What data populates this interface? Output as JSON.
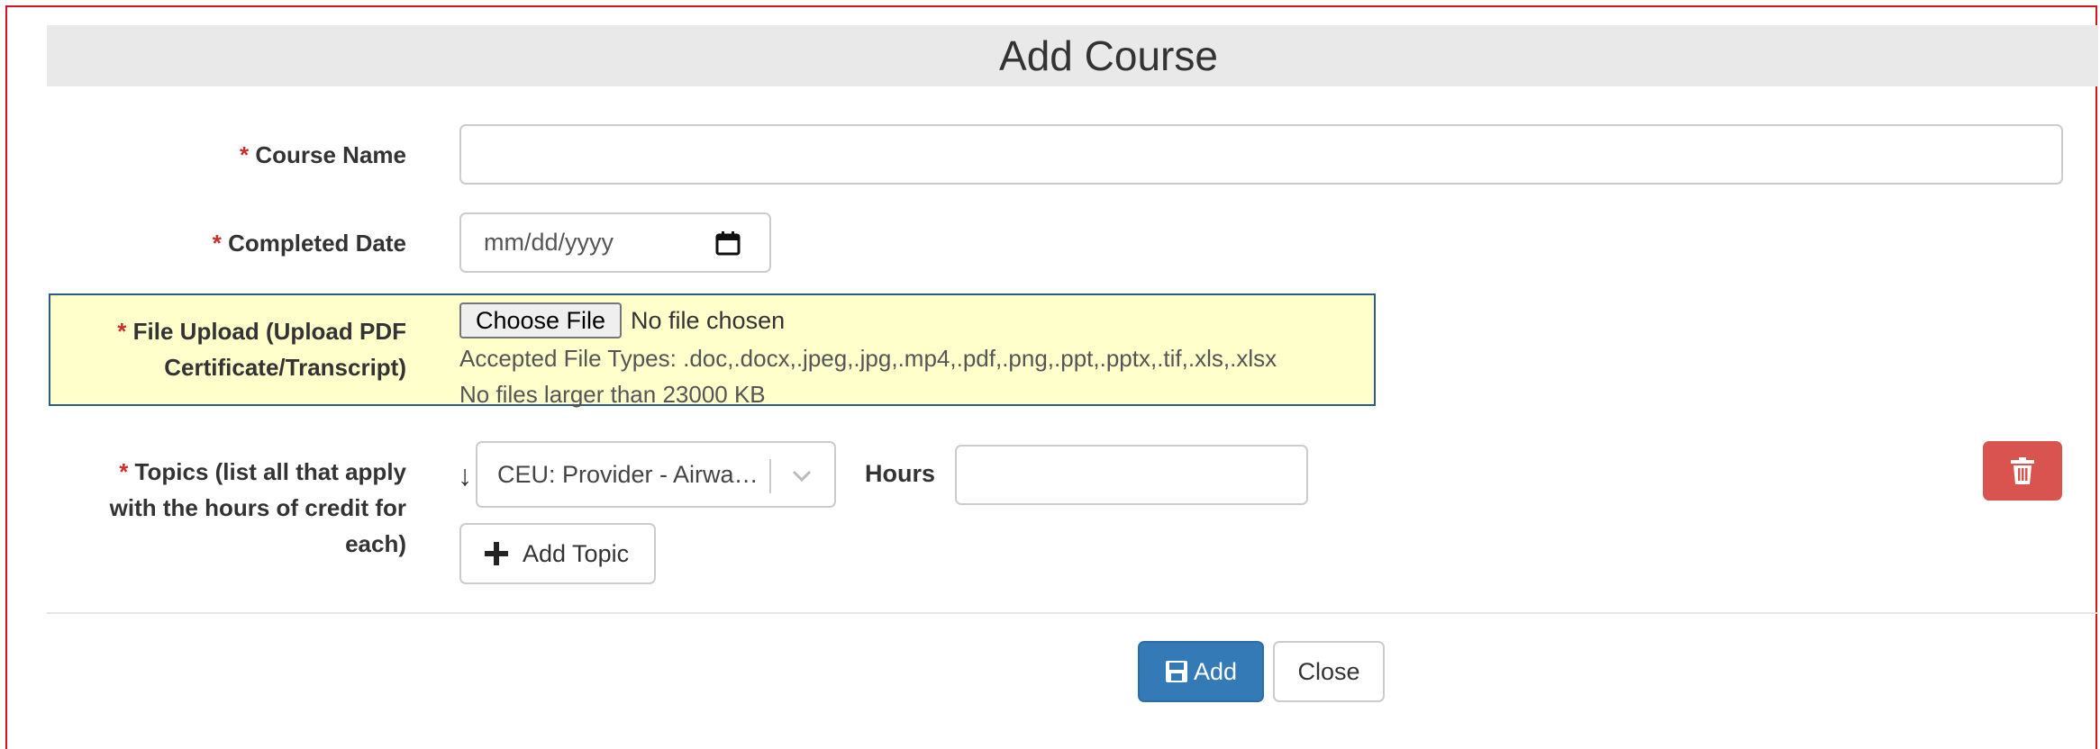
{
  "modal": {
    "title": "Add Course"
  },
  "form": {
    "course_name": {
      "required_mark": "*",
      "label": "Course Name",
      "value": ""
    },
    "completed_date": {
      "required_mark": "*",
      "label": "Completed Date",
      "placeholder": "mm/dd/yyyy"
    },
    "file_upload": {
      "required_mark": "*",
      "label_line1": "File Upload (Upload PDF",
      "label_line2": "Certificate/Transcript)",
      "button_label": "Choose File",
      "status": "No file chosen",
      "accepted_types": "Accepted File Types: .doc,.docx,.jpeg,.jpg,.mp4,.pdf,.png,.ppt,.pptx,.tif,.xls,.xlsx",
      "size_limit": "No files larger than 23000 KB",
      "highlight_color": "#ffffcc"
    },
    "topics": {
      "required_mark": "*",
      "label_line1": "Topics (list all that apply",
      "label_line2": "with the hours of credit for",
      "label_line3": "each)",
      "sort_icon": "sort-arrow-icon",
      "selected_topic": "CEU: Provider - Airwa…",
      "hours_label": "Hours",
      "hours_value": "",
      "add_topic_label": "Add Topic",
      "delete_icon": "trash-icon"
    }
  },
  "footer": {
    "add_label": "Add",
    "close_label": "Close"
  },
  "colors": {
    "primary": "#337ab7",
    "danger": "#d9534f",
    "required": "#c9302c",
    "frame_border": "#d9121b"
  }
}
